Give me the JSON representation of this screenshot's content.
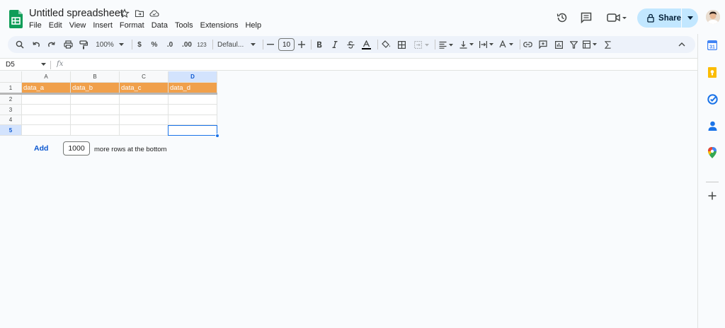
{
  "document": {
    "title": "Untitled spreadsheet"
  },
  "menu": [
    "File",
    "Edit",
    "View",
    "Insert",
    "Format",
    "Data",
    "Tools",
    "Extensions",
    "Help"
  ],
  "share": {
    "label": "Share"
  },
  "toolbar": {
    "zoom": "100%",
    "currency": "$",
    "percent": "%",
    "decrease_decimal": ".0",
    "increase_decimal": ".00",
    "more_formats": "123",
    "font": "Defaul...",
    "font_size": "10"
  },
  "formula_bar": {
    "cell_ref": "D5",
    "fx": "fx"
  },
  "grid": {
    "columns": [
      "A",
      "B",
      "C",
      "D"
    ],
    "selected_column": "D",
    "rows": [
      "1",
      "2",
      "3",
      "4",
      "5"
    ],
    "selected_row": "5",
    "header_cells": [
      "data_a",
      "data_b",
      "data_c",
      "data_d"
    ],
    "header_color": "#f0a04b"
  },
  "add_rows": {
    "button": "Add",
    "count": "1000",
    "suffix": "more rows at the bottom"
  },
  "colors": {
    "accent": "#1a73e8",
    "share_bg": "#c2e7ff",
    "sheets_green": "#0f9d58"
  },
  "side_panel": {
    "icons": [
      "calendar-icon",
      "keep-icon",
      "tasks-icon",
      "contacts-icon",
      "maps-icon",
      "add-icon"
    ]
  }
}
